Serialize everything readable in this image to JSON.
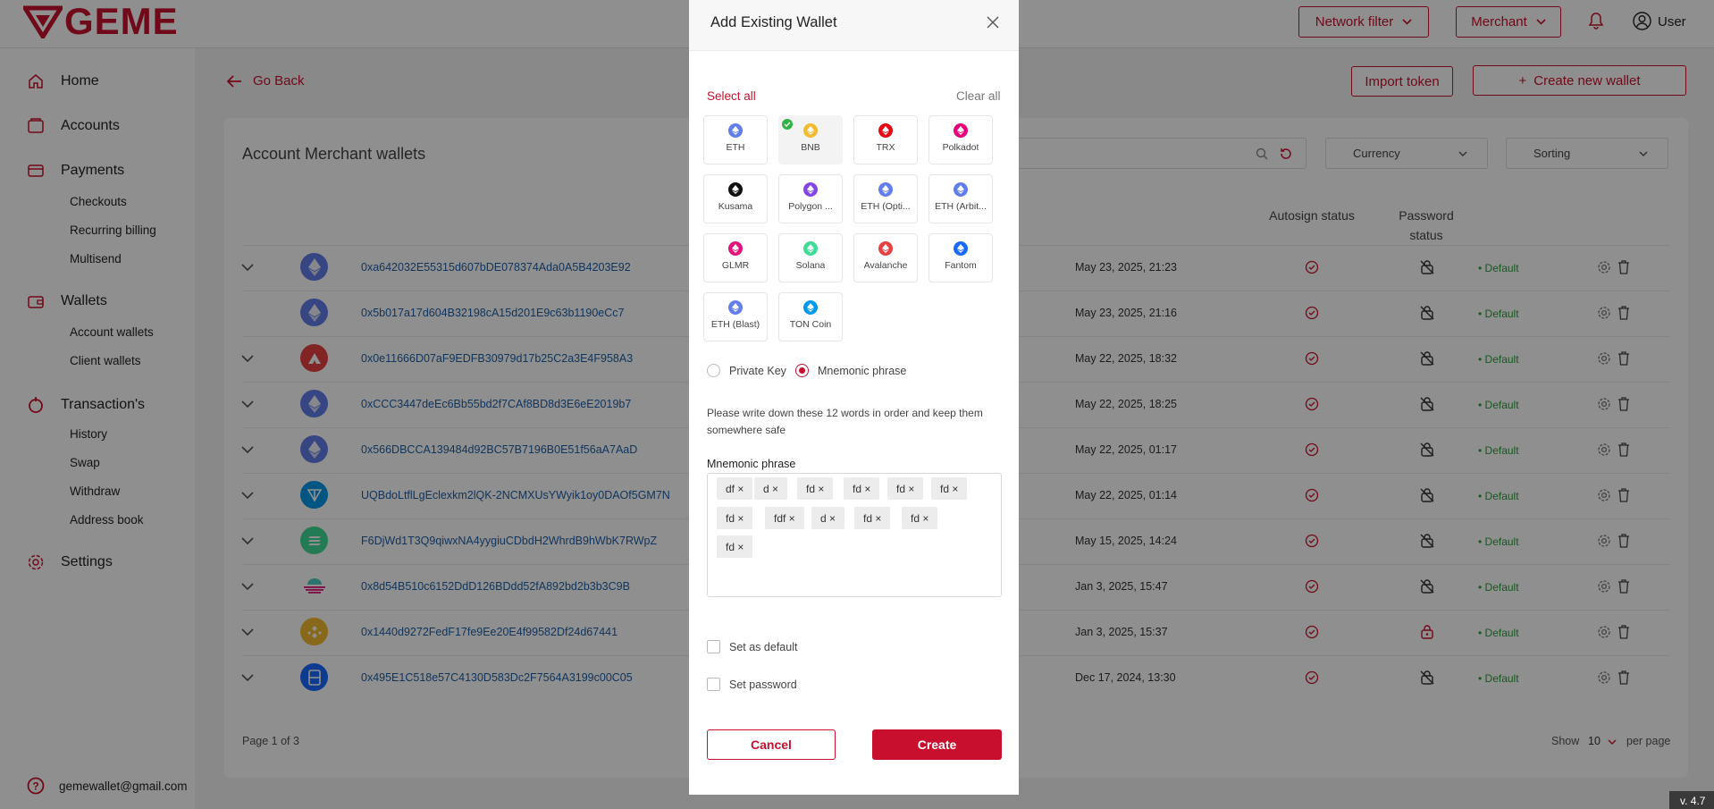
{
  "header": {
    "logo_text": "GEME",
    "network_filter_label": "Network filter",
    "merchant_label": "Merchant",
    "user_label": "User"
  },
  "sidebar": {
    "items": [
      {
        "label": "Home"
      },
      {
        "label": "Accounts"
      },
      {
        "label": "Payments",
        "children": [
          "Checkouts",
          "Recurring billing",
          "Multisend"
        ]
      },
      {
        "label": "Wallets",
        "children": [
          "Account wallets",
          "Client wallets"
        ]
      },
      {
        "label": "Transaction's",
        "children": [
          "History",
          "Swap",
          "Withdraw",
          "Address book"
        ]
      },
      {
        "label": "Settings"
      }
    ],
    "footer_email": "gemewallet@gmail.com"
  },
  "main": {
    "go_back_label": "Go Back",
    "import_token_label": "Import token",
    "create_wallet_label": "Create new wallet",
    "card_title": "Account Merchant wallets",
    "currency_label": "Currency",
    "sorting_label": "Sorting",
    "col_autosign": "Autosign status",
    "col_password": "Password status",
    "rows": [
      {
        "address": "0xa642032E55315d607bDE078374Ada0A5B4203E92",
        "date": "May 23, 2025, 21:23",
        "status": "• Default",
        "coin": "eth",
        "expand": true,
        "pw": "off"
      },
      {
        "address": "0x5b017a17d604B32198cA15d201E9c63b1190eCc7",
        "date": "May 23, 2025, 21:16",
        "status": "• Default",
        "coin": "eth",
        "expand": false,
        "pw": "off"
      },
      {
        "address": "0x0e11666D07aF9EDFB30979d17b25C2a3E4F958A3",
        "date": "May 22, 2025, 18:32",
        "status": "• Default",
        "coin": "avax",
        "expand": true,
        "pw": "off"
      },
      {
        "address": "0xCCC3447deEc6Bb55bd2f7CAf8BD8d3E6eE2019b7",
        "date": "May 22, 2025, 18:25",
        "status": "• Default",
        "coin": "eth",
        "expand": true,
        "pw": "off"
      },
      {
        "address": "0x566DBCCA139484d92BC57B7196B0E51f56aA7AaD",
        "date": "May 22, 2025, 01:17",
        "status": "• Default",
        "coin": "eth",
        "expand": true,
        "pw": "off"
      },
      {
        "address": "UQBdoLtflLgEclexkm2lQK-2NCMXUsYWyik1oy0DAOf5GM7N",
        "date": "May 22, 2025, 01:14",
        "status": "• Default",
        "coin": "ton",
        "expand": true,
        "pw": "off"
      },
      {
        "address": "F6DjWd1T3Q9qiwxNA4yygiuCDbdH2WhrdB9hWbK7RWpZ",
        "date": "May 15, 2025, 14:24",
        "status": "• Default",
        "coin": "sol",
        "expand": true,
        "pw": "off"
      },
      {
        "address": "0x8d54B510c6152DdD126BDdd52fA892bd2b3b3C9B",
        "date": "Jan 3, 2025, 15:47",
        "status": "• Default",
        "coin": "glmr",
        "expand": true,
        "pw": "off"
      },
      {
        "address": "0x1440d9272FedF17fe9Ee20E4f99582Df24d67441",
        "date": "Jan 3, 2025, 15:37",
        "status": "• Default",
        "coin": "bnb",
        "expand": true,
        "pw": "on"
      },
      {
        "address": "0x495E1C518e57C4130D583Dc2F7564A3199c00C05",
        "date": "Dec 17, 2024, 13:30",
        "status": "• Default",
        "coin": "ftm",
        "expand": true,
        "pw": "off"
      }
    ],
    "page_info": "Page 1 of 3",
    "show_label": "Show",
    "per_page_value": "10",
    "per_page_label": "per page"
  },
  "modal": {
    "title": "Add Existing Wallet",
    "select_all": "Select all",
    "clear_all": "Clear all",
    "chains": [
      {
        "label": "ETH",
        "color": "#627eea",
        "selected": false
      },
      {
        "label": "BNB",
        "color": "#f3ba2f",
        "selected": true
      },
      {
        "label": "TRX",
        "color": "#e50915",
        "selected": false
      },
      {
        "label": "Polkadot",
        "color": "#e6007a",
        "selected": false
      },
      {
        "label": "Kusama",
        "color": "#111111",
        "selected": false
      },
      {
        "label": "Polygon ...",
        "color": "#8247e5",
        "selected": false
      },
      {
        "label": "ETH (Opti...",
        "color": "#627eea",
        "selected": false
      },
      {
        "label": "ETH (Arbit...",
        "color": "#627eea",
        "selected": false
      },
      {
        "label": "GLMR",
        "color": "#e1147b",
        "selected": false
      },
      {
        "label": "Solana",
        "color": "#3ddc97",
        "selected": false
      },
      {
        "label": "Avalanche",
        "color": "#e84142",
        "selected": false
      },
      {
        "label": "Fantom",
        "color": "#1969ff",
        "selected": false
      },
      {
        "label": "ETH (Blast)",
        "color": "#627eea",
        "selected": false
      },
      {
        "label": "TON Coin",
        "color": "#0098ea",
        "selected": false
      }
    ],
    "radio_private_key": "Private Key",
    "radio_mnemonic": "Mnemonic phrase",
    "hint": "Please write down these 12 words in order and keep them somewhere safe",
    "mnemonic_label": "Mnemonic phrase",
    "words": [
      "df ×",
      "d ×",
      "fd ×",
      "fd ×",
      "fd ×",
      "fd ×",
      "fd ×",
      "fdf ×",
      "d ×",
      "fd ×",
      "fd ×",
      "fd ×"
    ],
    "set_default_label": "Set as default",
    "set_password_label": "Set password",
    "cancel_label": "Cancel",
    "create_label": "Create"
  },
  "version": "v. 4.7",
  "colors": {
    "brand": "#c8102e",
    "link": "#1f5fa6",
    "success": "#2a9d3b"
  }
}
